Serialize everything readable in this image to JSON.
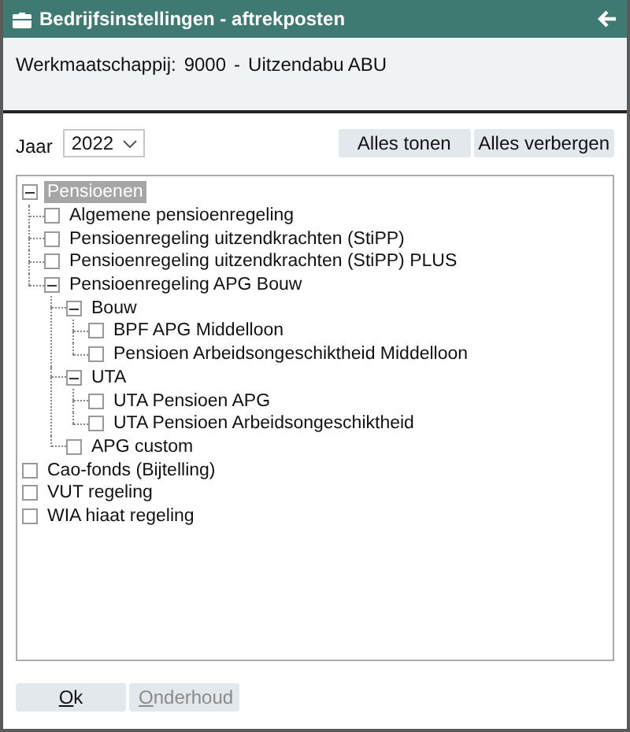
{
  "window": {
    "title": "Bedrijfsinstellingen - aftrekposten"
  },
  "company": {
    "label": "Werkmaatschappij:",
    "code": "9000",
    "separator": "-",
    "name": "Uitzendabu ABU"
  },
  "filter": {
    "label": "Jaar",
    "year": "2022"
  },
  "toolbar_buttons": [
    "Alles tonen",
    "Alles verbergen"
  ],
  "tree": [
    {
      "label": "Pensioenen",
      "selected": true,
      "expanded": true,
      "children": [
        {
          "label": "Algemene pensioenregeling",
          "selected": false,
          "checked": false
        },
        {
          "label": "Pensioenregeling uitzendkrachten (StiPP)",
          "selected": false,
          "checked": false
        },
        {
          "label": "Pensioenregeling uitzendkrachten (StiPP) PLUS",
          "selected": false,
          "checked": false
        },
        {
          "label": "Pensioenregeling APG Bouw",
          "selected": false,
          "expanded": true,
          "children": [
            {
              "label": "Bouw",
              "selected": false,
              "expanded": true,
              "children": [
                {
                  "label": "BPF APG Middelloon",
                  "selected": false,
                  "checked": false
                },
                {
                  "label": "Pensioen Arbeidsongeschiktheid Middelloon",
                  "selected": false,
                  "checked": false
                }
              ]
            },
            {
              "label": "UTA",
              "selected": false,
              "expanded": true,
              "children": [
                {
                  "label": "UTA Pensioen APG",
                  "selected": false,
                  "checked": false
                },
                {
                  "label": "UTA Pensioen Arbeidsongeschiktheid",
                  "selected": false,
                  "checked": false
                }
              ]
            },
            {
              "label": "APG custom",
              "selected": false,
              "checked": false
            }
          ]
        }
      ]
    },
    {
      "label": "Cao-fonds (Bijtelling)",
      "selected": false,
      "checked": false
    },
    {
      "label": "VUT regeling",
      "selected": false,
      "checked": false
    },
    {
      "label": "WIA hiaat regeling",
      "selected": false,
      "checked": false
    }
  ],
  "footer_buttons": [
    {
      "label": "Ok",
      "disabled": false,
      "underline_first": true
    },
    {
      "label": "Onderhoud",
      "disabled": true,
      "underline_first": true
    }
  ]
}
